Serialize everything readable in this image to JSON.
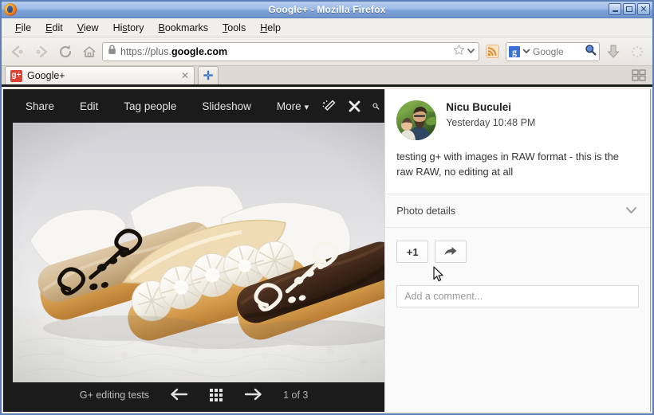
{
  "window": {
    "title": "Google+ - Mozilla Firefox",
    "app_icon": "firefox-logo",
    "minimize_label": "_",
    "maximize_label": "□",
    "close_label": "✕"
  },
  "menubar": {
    "items": [
      {
        "label": "File",
        "accel": "F"
      },
      {
        "label": "Edit",
        "accel": "E"
      },
      {
        "label": "View",
        "accel": "V"
      },
      {
        "label": "History",
        "accel": "s"
      },
      {
        "label": "Bookmarks",
        "accel": "B"
      },
      {
        "label": "Tools",
        "accel": "T"
      },
      {
        "label": "Help",
        "accel": "H"
      }
    ]
  },
  "navbar": {
    "back_icon": "back-arrow-icon",
    "forward_icon": "forward-arrow-icon",
    "reload_icon": "reload-icon",
    "home_icon": "home-icon",
    "lock_icon": "padlock-icon",
    "url_scheme": "https://plus.",
    "url_domain": "google.com",
    "bookmark_icon": "star-icon",
    "bookmark_chevron_icon": "chevron-down-icon",
    "feed_icon": "rss-feed-icon",
    "search_engine_icon": "google-g-icon",
    "search_engine_letter": "g",
    "search_engine_chevron_icon": "chevron-down-icon",
    "search_placeholder": "Google",
    "search_go_icon": "magnifier-icon",
    "downloads_icon": "download-arrow-icon",
    "activity_icon": "throbber-icon"
  },
  "tabs": {
    "items": [
      {
        "favicon": "google-plus-favicon",
        "favicon_text": "g+",
        "label": "Google+",
        "close_icon": "close-icon",
        "close_label": "✕"
      }
    ],
    "new_tab_icon": "new-tab-plus-icon",
    "new_tab_label": "✛",
    "list_all_tabs_icon": "list-all-tabs-icon"
  },
  "viewer": {
    "toolbar_buttons": [
      {
        "label": "Share"
      },
      {
        "label": "Edit"
      },
      {
        "label": "Tag people"
      },
      {
        "label": "Slideshow"
      },
      {
        "label": "More",
        "chevron": "▾"
      }
    ],
    "icons": [
      {
        "name": "auto-enhance-icon"
      },
      {
        "name": "close-icon"
      },
      {
        "name": "zoom-magnifier-icon"
      }
    ],
    "photo": {
      "alt": "Three eclairs on white paper doily",
      "description": "A coffee-glazed eclair with dark chocolate swirls, a cream-filled eclair dusted with powdered sugar, and a chocolate-glazed eclair with white icing swirls"
    },
    "bottombar": {
      "album_name": "G+ editing tests",
      "prev_icon": "arrow-left-icon",
      "grid_icon": "grid-view-icon",
      "next_icon": "arrow-right-icon",
      "counter": "1 of 3"
    }
  },
  "panel": {
    "avatar": "user-avatar",
    "author": "Nicu Buculei",
    "timestamp": "Yesterday 10:48 PM",
    "caption": "testing g+ with images in RAW format - this is the raw RAW, no editing at all",
    "details_label": "Photo details",
    "details_chevron_icon": "chevron-down-icon",
    "plus_one_label": "+1",
    "share_icon": "share-arrow-icon",
    "comment_placeholder": "Add a comment..."
  },
  "colors": {
    "titlebar_top": "#b7cdec",
    "titlebar_bottom": "#6f95cf",
    "viewer_bg": "#1b1b1b",
    "panel_bg": "#ffffff",
    "accent_blue": "#3b6fd4",
    "favicon_red": "#d94234"
  }
}
